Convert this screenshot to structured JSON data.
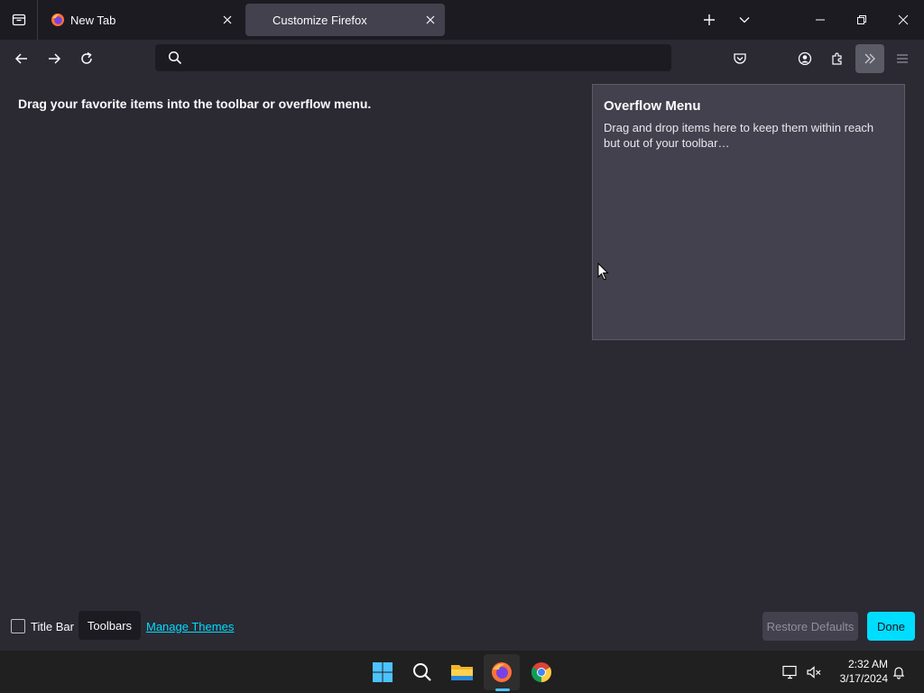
{
  "tabs": [
    {
      "label": "New Tab",
      "active": false
    },
    {
      "label": "Customize Firefox",
      "active": true
    }
  ],
  "urlbar": {
    "value": ""
  },
  "customize": {
    "palette_title": "Drag your favorite items into the toolbar or overflow menu.",
    "overflow_title": "Overflow Menu",
    "overflow_desc": "Drag and drop items here to keep them within reach but out of your toolbar…"
  },
  "footer": {
    "titlebar_label": "Title Bar",
    "titlebar_checked": false,
    "toolbars_label": "Toolbars",
    "themes_link": "Manage Themes",
    "restore_label": "Restore Defaults",
    "done_label": "Done"
  },
  "taskbar": {
    "time": "2:32 AM",
    "date": "3/17/2024",
    "apps": [
      "start-icon",
      "search-icon",
      "file-explorer-icon",
      "firefox-icon",
      "chrome-icon"
    ]
  },
  "colors": {
    "accent": "#00ddff",
    "bg": "#2b2a33",
    "panel": "#42414d"
  }
}
